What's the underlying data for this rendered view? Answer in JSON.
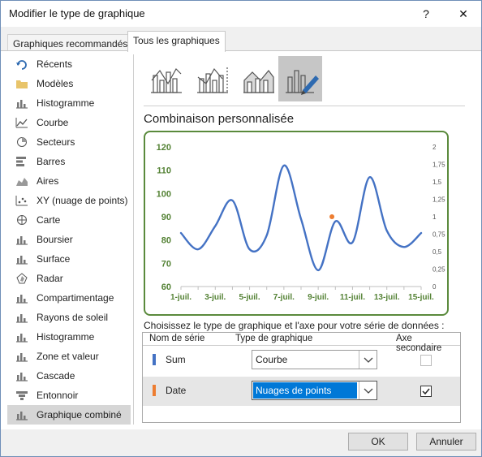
{
  "window": {
    "title": "Modifier le type de graphique",
    "help": "?",
    "close": "✕"
  },
  "tabs": [
    {
      "label": "Graphiques recommandés"
    },
    {
      "label": "Tous les graphiques"
    }
  ],
  "sidebar": {
    "items": [
      {
        "label": "Récents",
        "icon": "recent-icon"
      },
      {
        "label": "Modèles",
        "icon": "folder-icon"
      },
      {
        "label": "Histogramme",
        "icon": "column-chart-icon"
      },
      {
        "label": "Courbe",
        "icon": "line-chart-icon"
      },
      {
        "label": "Secteurs",
        "icon": "pie-chart-icon"
      },
      {
        "label": "Barres",
        "icon": "bar-chart-icon"
      },
      {
        "label": "Aires",
        "icon": "area-chart-icon"
      },
      {
        "label": "XY (nuage de points)",
        "icon": "scatter-chart-icon"
      },
      {
        "label": "Carte",
        "icon": "map-chart-icon"
      },
      {
        "label": "Boursier",
        "icon": "stock-chart-icon"
      },
      {
        "label": "Surface",
        "icon": "surface-chart-icon"
      },
      {
        "label": "Radar",
        "icon": "radar-chart-icon"
      },
      {
        "label": "Compartimentage",
        "icon": "treemap-chart-icon"
      },
      {
        "label": "Rayons de soleil",
        "icon": "sunburst-chart-icon"
      },
      {
        "label": "Histogramme",
        "icon": "histogram-chart-icon"
      },
      {
        "label": "Zone et valeur",
        "icon": "box-whisker-chart-icon"
      },
      {
        "label": "Cascade",
        "icon": "waterfall-chart-icon"
      },
      {
        "label": "Entonnoir",
        "icon": "funnel-chart-icon"
      },
      {
        "label": "Graphique combiné",
        "icon": "combo-chart-icon"
      }
    ],
    "selected_index": 18
  },
  "combo": {
    "title": "Combinaison personnalisée"
  },
  "instruction": "Choisissez le type de graphique et l'axe pour votre série de données :",
  "series_table": {
    "headers": {
      "name": "Nom de série",
      "type": "Type de graphique",
      "secondary": "Axe secondaire"
    },
    "rows": [
      {
        "name": "Sum",
        "type": "Courbe",
        "secondary": false,
        "color": "#4472c4"
      },
      {
        "name": "Date",
        "type": "Nuages de points",
        "secondary": true,
        "color": "#ed7d31"
      }
    ]
  },
  "buttons": {
    "ok": "OK",
    "cancel": "Annuler"
  },
  "colors": {
    "line": "#4472c4",
    "point": "#ed7d31",
    "axis_text": "#548235",
    "preview_border": "#5a8a3c"
  },
  "chart_data": {
    "type": "line",
    "x": [
      "1-juil.",
      "2-juil.",
      "3-juil.",
      "4-juil.",
      "5-juil.",
      "6-juil.",
      "7-juil.",
      "8-juil.",
      "9-juil.",
      "10-juil.",
      "11-juil.",
      "12-juil.",
      "13-juil.",
      "14-juil.",
      "15-juil."
    ],
    "x_tick_labels": [
      "1-juil.",
      "3-juil.",
      "5-juil.",
      "7-juil.",
      "9-juil.",
      "11-juil.",
      "13-juil.",
      "15-juil."
    ],
    "series": [
      {
        "values": [
          83,
          76,
          86,
          97,
          76,
          82,
          112,
          89,
          67,
          88,
          79,
          107,
          84,
          77,
          83
        ],
        "axis": "primary",
        "type": "line",
        "color": "#4472c4"
      },
      {
        "points": [
          {
            "x": "9-juil.",
            "x_offset": 0.8,
            "y": 1
          }
        ],
        "axis": "secondary",
        "type": "scatter",
        "color": "#ed7d31"
      }
    ],
    "ylim": [
      60,
      120
    ],
    "y_ticks": [
      "120",
      "110",
      "100",
      "90",
      "80",
      "70",
      "60"
    ],
    "y2lim": [
      0,
      2
    ],
    "y2_ticks": [
      "2",
      "1,75",
      "1,5",
      "1,25",
      "1",
      "0,75",
      "0,5",
      "0,25",
      "0"
    ],
    "grid": false,
    "legend": "none"
  }
}
